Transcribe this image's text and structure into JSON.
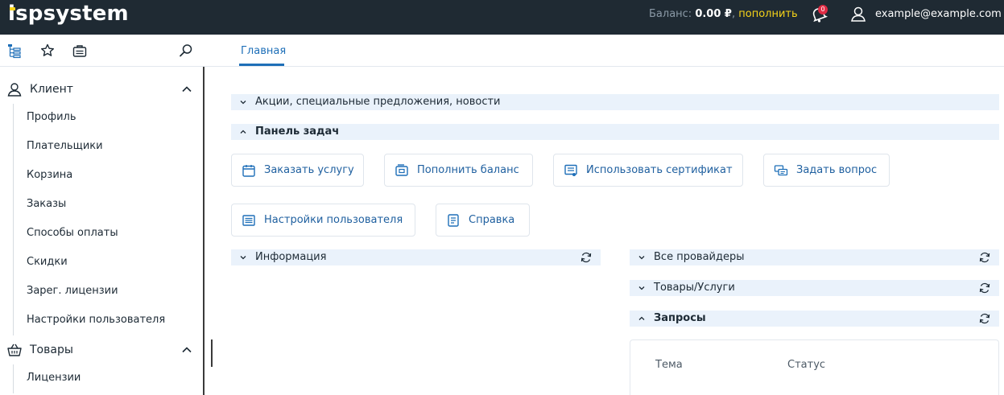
{
  "brand": {
    "logo_text": "ispsystem",
    "accent": "#f7d419",
    "topbar_color": "#1f2a33",
    "link_color": "#1e6fb8"
  },
  "header": {
    "balance_label": "Баланс:",
    "balance_amount": "0.00 ₽",
    "balance_separator": ",",
    "topup_label": "пополнить",
    "notifications_count": "0",
    "user_email": "example@example.com"
  },
  "toolbar": {
    "icons": [
      "tree-menu-icon",
      "star-icon",
      "briefcase-icon",
      "search-icon"
    ],
    "active_tab": "Главная"
  },
  "sidebar": {
    "groups": [
      {
        "label": "Клиент",
        "icon": "user-icon",
        "expanded": true,
        "items": [
          "Профиль",
          "Плательщики",
          "Корзина",
          "Заказы",
          "Способы оплаты",
          "Скидки",
          "Зарег. лицензии",
          "Настройки пользователя"
        ]
      },
      {
        "label": "Товары",
        "icon": "basket-icon",
        "expanded": true,
        "items": [
          "Лицензии"
        ]
      }
    ]
  },
  "main": {
    "news_section": "Акции, специальные предложения, новости",
    "tasks_section": "Панель задач",
    "tasks": [
      {
        "label": "Заказать услугу",
        "icon": "calendar-icon"
      },
      {
        "label": "Пополнить баланс",
        "icon": "wallet-icon"
      },
      {
        "label": "Использовать сертификат",
        "icon": "certificate-icon"
      },
      {
        "label": "Задать вопрос",
        "icon": "chat-icon"
      },
      {
        "label": "Настройки пользователя",
        "icon": "settings-list-icon"
      },
      {
        "label": "Справка",
        "icon": "document-icon"
      }
    ],
    "info_section": "Информация",
    "providers_section": "Все провайдеры",
    "goods_section": "Товары/Услуги",
    "requests_section": "Запросы",
    "requests_table": {
      "columns": [
        "Тема",
        "Статус"
      ]
    }
  }
}
